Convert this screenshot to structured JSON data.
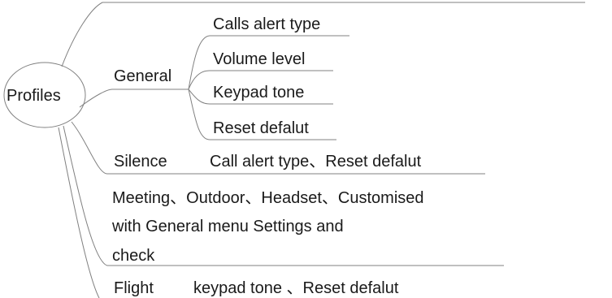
{
  "root": {
    "label": "Profiles"
  },
  "general": {
    "label": "General",
    "items": [
      "Calls alert type",
      "Volume level",
      "Keypad tone",
      "Reset defalut"
    ]
  },
  "silence": {
    "label": "Silence",
    "detail": "Call alert type、Reset defalut"
  },
  "meeting": {
    "lines": [
      "Meeting、Outdoor、Headset、Customised",
      "with General menu Settings and",
      "check"
    ]
  },
  "flight": {
    "label": "Flight",
    "detail": "keypad tone 、Reset defalut"
  },
  "colors": {
    "line": "#808080",
    "text": "#1a1a1a",
    "background": "#ffffff"
  }
}
